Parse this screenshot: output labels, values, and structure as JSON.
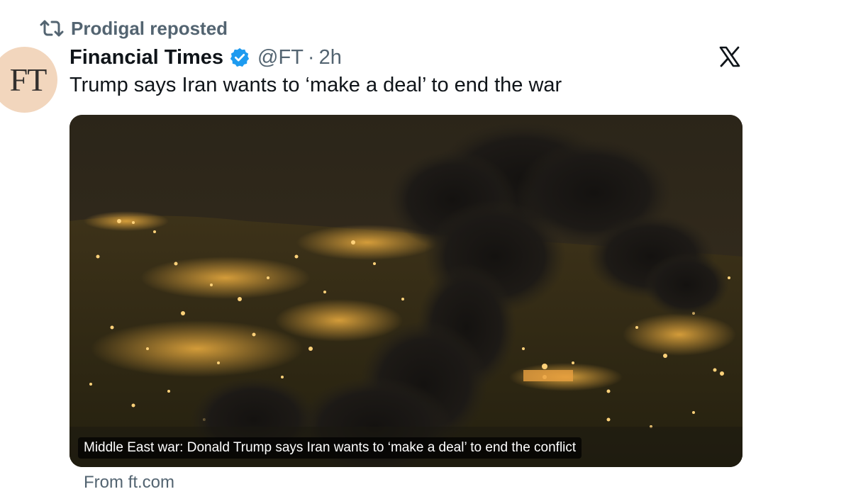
{
  "repost": {
    "icon": "repost-icon",
    "text": "Prodigal reposted"
  },
  "author": {
    "avatar_text": "FT",
    "name": "Financial Times",
    "verified_icon": "verified-badge-icon",
    "handle": "@FT",
    "separator": "·",
    "time": "2h"
  },
  "platform_icon": "x-logo-icon",
  "tweet": {
    "text": "Trump says Iran wants to ‘make a deal’ to end the war"
  },
  "card": {
    "image_description_icon": "news-photo",
    "caption": "Middle East war: Donald Trump says Iran wants to ‘make a deal’ to end the conflict",
    "source": "From ft.com"
  },
  "colors": {
    "muted_text": "#536471",
    "verified_blue": "#1d9bf0",
    "avatar_bg": "#f2d6bd"
  }
}
